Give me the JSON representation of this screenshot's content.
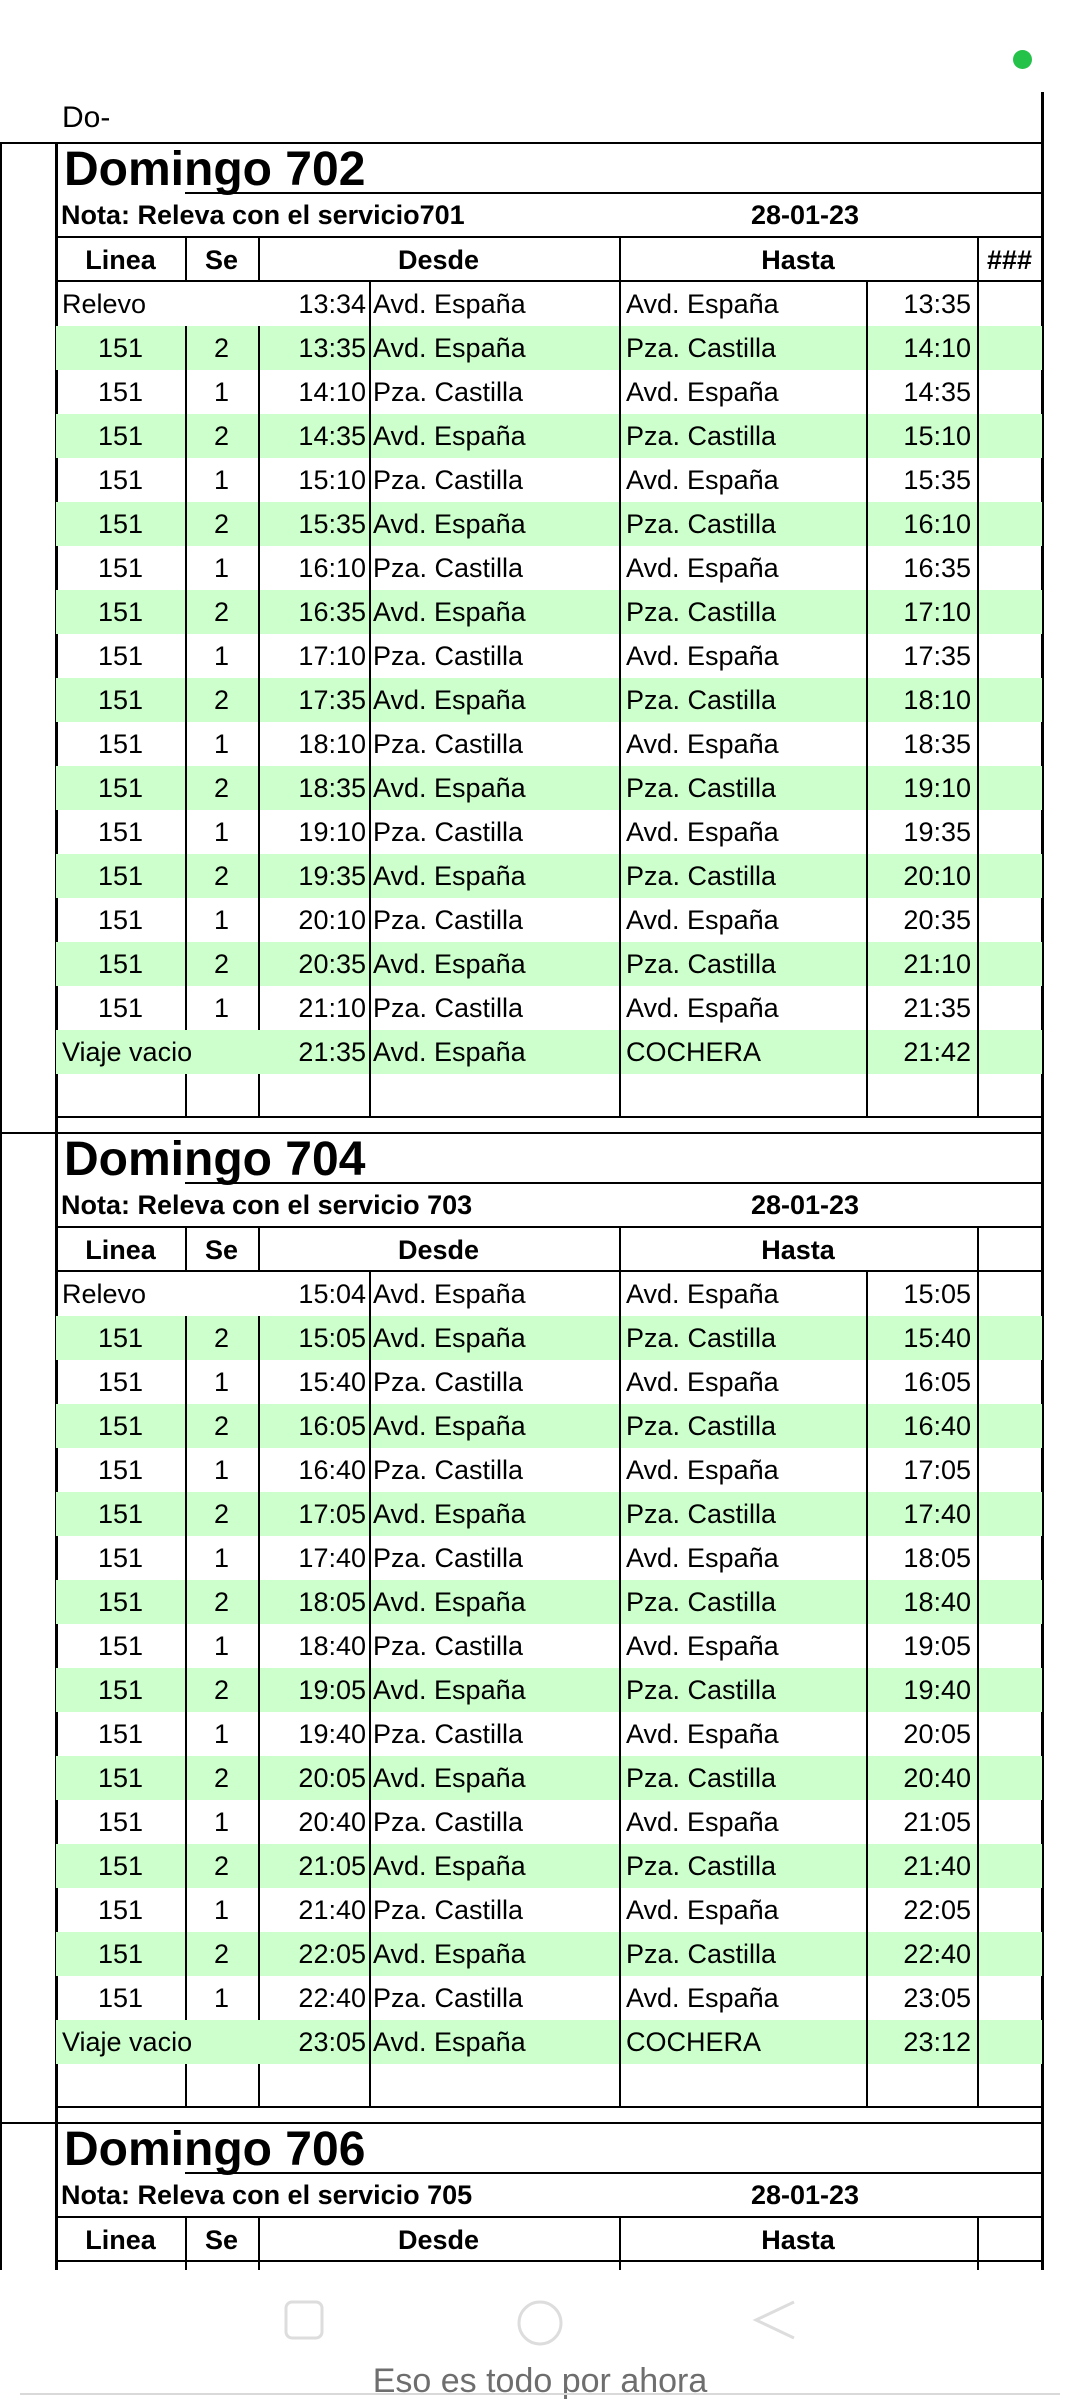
{
  "status": {
    "indicator_color": "#25c24a"
  },
  "document": {
    "doc_label": "Do-"
  },
  "columns": {
    "linea": "Linea",
    "se": "Se",
    "desde": "Desde",
    "hasta": "Hasta",
    "extra": "###"
  },
  "colors": {
    "row_band": "#ccffcc"
  },
  "blocks": [
    {
      "title": "Domingo 702",
      "nota": "Nota: Releva con el servicio701",
      "fecha": "28-01-23",
      "show_extra_header": true,
      "rows": [
        {
          "linea": "Relevo",
          "se": "",
          "salida": "13:34",
          "desde": "Avd. España",
          "hasta": "Avd. España",
          "llegada": "13:35"
        },
        {
          "linea": "151",
          "se": "2",
          "salida": "13:35",
          "desde": "Avd. España",
          "hasta": "Pza. Castilla",
          "llegada": "14:10"
        },
        {
          "linea": "151",
          "se": "1",
          "salida": "14:10",
          "desde": "Pza. Castilla",
          "hasta": "Avd. España",
          "llegada": "14:35"
        },
        {
          "linea": "151",
          "se": "2",
          "salida": "14:35",
          "desde": "Avd. España",
          "hasta": "Pza. Castilla",
          "llegada": "15:10"
        },
        {
          "linea": "151",
          "se": "1",
          "salida": "15:10",
          "desde": "Pza. Castilla",
          "hasta": "Avd. España",
          "llegada": "15:35"
        },
        {
          "linea": "151",
          "se": "2",
          "salida": "15:35",
          "desde": "Avd. España",
          "hasta": "Pza. Castilla",
          "llegada": "16:10"
        },
        {
          "linea": "151",
          "se": "1",
          "salida": "16:10",
          "desde": "Pza. Castilla",
          "hasta": "Avd. España",
          "llegada": "16:35"
        },
        {
          "linea": "151",
          "se": "2",
          "salida": "16:35",
          "desde": "Avd. España",
          "hasta": "Pza. Castilla",
          "llegada": "17:10"
        },
        {
          "linea": "151",
          "se": "1",
          "salida": "17:10",
          "desde": "Pza. Castilla",
          "hasta": "Avd. España",
          "llegada": "17:35"
        },
        {
          "linea": "151",
          "se": "2",
          "salida": "17:35",
          "desde": "Avd. España",
          "hasta": "Pza. Castilla",
          "llegada": "18:10"
        },
        {
          "linea": "151",
          "se": "1",
          "salida": "18:10",
          "desde": "Pza. Castilla",
          "hasta": "Avd. España",
          "llegada": "18:35"
        },
        {
          "linea": "151",
          "se": "2",
          "salida": "18:35",
          "desde": "Avd. España",
          "hasta": "Pza. Castilla",
          "llegada": "19:10"
        },
        {
          "linea": "151",
          "se": "1",
          "salida": "19:10",
          "desde": "Pza. Castilla",
          "hasta": "Avd. España",
          "llegada": "19:35"
        },
        {
          "linea": "151",
          "se": "2",
          "salida": "19:35",
          "desde": "Avd. España",
          "hasta": "Pza. Castilla",
          "llegada": "20:10"
        },
        {
          "linea": "151",
          "se": "1",
          "salida": "20:10",
          "desde": "Pza. Castilla",
          "hasta": "Avd. España",
          "llegada": "20:35"
        },
        {
          "linea": "151",
          "se": "2",
          "salida": "20:35",
          "desde": "Avd. España",
          "hasta": "Pza. Castilla",
          "llegada": "21:10"
        },
        {
          "linea": "151",
          "se": "1",
          "salida": "21:10",
          "desde": "Pza. Castilla",
          "hasta": "Avd. España",
          "llegada": "21:35"
        },
        {
          "linea": "Viaje vacio",
          "se": "",
          "salida": "21:35",
          "desde": "Avd. España",
          "hasta": "COCHERA",
          "llegada": "21:42"
        }
      ]
    },
    {
      "title": "Domingo 704",
      "nota": "Nota: Releva con el servicio 703",
      "fecha": "28-01-23",
      "show_extra_header": false,
      "rows": [
        {
          "linea": "Relevo",
          "se": "",
          "salida": "15:04",
          "desde": "Avd. España",
          "hasta": "Avd. España",
          "llegada": "15:05"
        },
        {
          "linea": "151",
          "se": "2",
          "salida": "15:05",
          "desde": "Avd. España",
          "hasta": "Pza. Castilla",
          "llegada": "15:40"
        },
        {
          "linea": "151",
          "se": "1",
          "salida": "15:40",
          "desde": "Pza. Castilla",
          "hasta": "Avd. España",
          "llegada": "16:05"
        },
        {
          "linea": "151",
          "se": "2",
          "salida": "16:05",
          "desde": "Avd. España",
          "hasta": "Pza. Castilla",
          "llegada": "16:40"
        },
        {
          "linea": "151",
          "se": "1",
          "salida": "16:40",
          "desde": "Pza. Castilla",
          "hasta": "Avd. España",
          "llegada": "17:05"
        },
        {
          "linea": "151",
          "se": "2",
          "salida": "17:05",
          "desde": "Avd. España",
          "hasta": "Pza. Castilla",
          "llegada": "17:40"
        },
        {
          "linea": "151",
          "se": "1",
          "salida": "17:40",
          "desde": "Pza. Castilla",
          "hasta": "Avd. España",
          "llegada": "18:05"
        },
        {
          "linea": "151",
          "se": "2",
          "salida": "18:05",
          "desde": "Avd. España",
          "hasta": "Pza. Castilla",
          "llegada": "18:40"
        },
        {
          "linea": "151",
          "se": "1",
          "salida": "18:40",
          "desde": "Pza. Castilla",
          "hasta": "Avd. España",
          "llegada": "19:05"
        },
        {
          "linea": "151",
          "se": "2",
          "salida": "19:05",
          "desde": "Avd. España",
          "hasta": "Pza. Castilla",
          "llegada": "19:40"
        },
        {
          "linea": "151",
          "se": "1",
          "salida": "19:40",
          "desde": "Pza. Castilla",
          "hasta": "Avd. España",
          "llegada": "20:05"
        },
        {
          "linea": "151",
          "se": "2",
          "salida": "20:05",
          "desde": "Avd. España",
          "hasta": "Pza. Castilla",
          "llegada": "20:40"
        },
        {
          "linea": "151",
          "se": "1",
          "salida": "20:40",
          "desde": "Pza. Castilla",
          "hasta": "Avd. España",
          "llegada": "21:05"
        },
        {
          "linea": "151",
          "se": "2",
          "salida": "21:05",
          "desde": "Avd. España",
          "hasta": "Pza. Castilla",
          "llegada": "21:40"
        },
        {
          "linea": "151",
          "se": "1",
          "salida": "21:40",
          "desde": "Pza. Castilla",
          "hasta": "Avd. España",
          "llegada": "22:05"
        },
        {
          "linea": "151",
          "se": "2",
          "salida": "22:05",
          "desde": "Avd. España",
          "hasta": "Pza. Castilla",
          "llegada": "22:40"
        },
        {
          "linea": "151",
          "se": "1",
          "salida": "22:40",
          "desde": "Pza. Castilla",
          "hasta": "Avd. España",
          "llegada": "23:05"
        },
        {
          "linea": "Viaje vacio",
          "se": "",
          "salida": "23:05",
          "desde": "Avd. España",
          "hasta": "COCHERA",
          "llegada": "23:12"
        }
      ]
    },
    {
      "title": "Domingo 706",
      "nota": "Nota: Releva con el servicio 705",
      "fecha": "28-01-23",
      "show_extra_header": false,
      "rows": []
    }
  ],
  "navbar": {
    "icons": [
      "square-icon",
      "circle-icon",
      "back-triangle-icon"
    ]
  },
  "toast": {
    "message": "Eso es todo por ahora"
  }
}
